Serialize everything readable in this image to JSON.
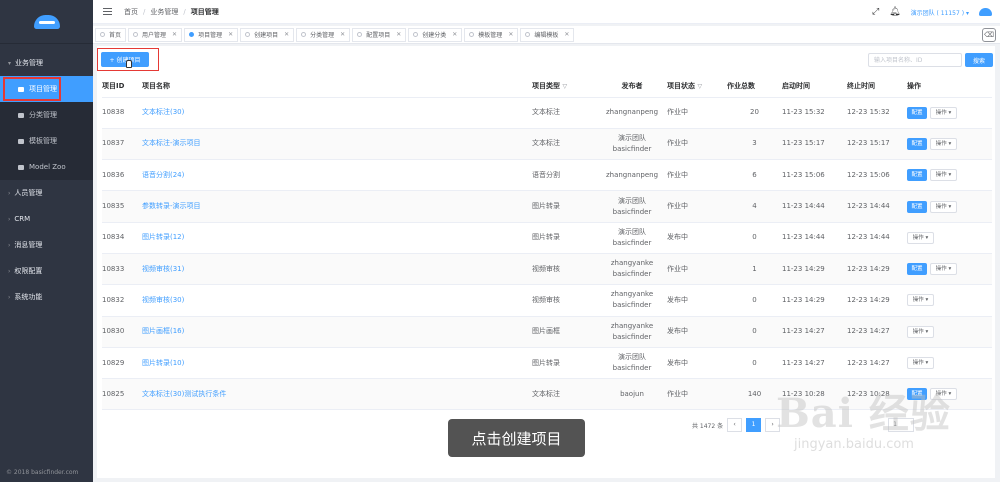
{
  "header": {
    "breadcrumb": [
      "首页",
      "业务管理",
      "项目管理"
    ],
    "user_label": "演示团队 ( 11157 ) ▾"
  },
  "sidebar": {
    "group_business": "业务管理",
    "items": [
      "项目管理",
      "分类管理",
      "模板管理",
      "Model Zoo"
    ],
    "groups": [
      "人员管理",
      "CRM",
      "消息管理",
      "权限配置",
      "系统功能"
    ],
    "footer": "© 2018 basicfinder.com"
  },
  "tabs": [
    {
      "label": "首页"
    },
    {
      "label": "用户管理"
    },
    {
      "label": "项目管理"
    },
    {
      "label": "创建项目"
    },
    {
      "label": "分类管理"
    },
    {
      "label": "配置项目"
    },
    {
      "label": "创建分类"
    },
    {
      "label": "模板管理"
    },
    {
      "label": "编辑模板"
    }
  ],
  "toolbar": {
    "create_label": "+ 创建项目",
    "search_placeholder": "输入项目名称、ID",
    "search_button": "搜索"
  },
  "table": {
    "headers": [
      "项目ID",
      "项目名称",
      "项目类型",
      "发布者",
      "项目状态",
      "作业总数",
      "启动时间",
      "终止时间",
      "操作"
    ],
    "filter_icon": "filter-icon",
    "config_label": "配置",
    "op_label": "操作 ▾",
    "rows": [
      {
        "id": "10838",
        "name": "文本标注(30)",
        "type": "文本标注",
        "publisher": [
          "zhangnanpeng"
        ],
        "status": "作业中",
        "total": "20",
        "start": "11-23 15:32",
        "end": "12-23 15:32",
        "config": true
      },
      {
        "id": "10837",
        "name": "文本标注-演示项目",
        "type": "文本标注",
        "publisher": [
          "演示团队",
          "basicfinder"
        ],
        "status": "作业中",
        "total": "3",
        "start": "11-23 15:17",
        "end": "12-23 15:17",
        "config": true
      },
      {
        "id": "10836",
        "name": "语音分割(24)",
        "type": "语音分割",
        "publisher": [
          "zhangnanpeng"
        ],
        "status": "作业中",
        "total": "6",
        "start": "11-23 15:06",
        "end": "12-23 15:06",
        "config": true
      },
      {
        "id": "10835",
        "name": "参数转录-演示项目",
        "type": "图片转录",
        "publisher": [
          "演示团队",
          "basicfinder"
        ],
        "status": "作业中",
        "total": "4",
        "start": "11-23 14:44",
        "end": "12-23 14:44",
        "config": true
      },
      {
        "id": "10834",
        "name": "图片转录(12)",
        "type": "图片转录",
        "publisher": [
          "演示团队",
          "basicfinder"
        ],
        "status": "发布中",
        "total": "0",
        "start": "11-23 14:44",
        "end": "12-23 14:44",
        "config": false
      },
      {
        "id": "10833",
        "name": "视频审核(31)",
        "type": "视频审核",
        "publisher": [
          "zhangyanke",
          "basicfinder"
        ],
        "status": "作业中",
        "total": "1",
        "start": "11-23 14:29",
        "end": "12-23 14:29",
        "config": true
      },
      {
        "id": "10832",
        "name": "视频审核(30)",
        "type": "视频审核",
        "publisher": [
          "zhangyanke",
          "basicfinder"
        ],
        "status": "发布中",
        "total": "0",
        "start": "11-23 14:29",
        "end": "12-23 14:29",
        "config": false
      },
      {
        "id": "10830",
        "name": "图片画框(16)",
        "type": "图片画框",
        "publisher": [
          "zhangyanke",
          "basicfinder"
        ],
        "status": "发布中",
        "total": "0",
        "start": "11-23 14:27",
        "end": "12-23 14:27",
        "config": false
      },
      {
        "id": "10829",
        "name": "图片转录(10)",
        "type": "图片转录",
        "publisher": [
          "演示团队",
          "basicfinder"
        ],
        "status": "发布中",
        "total": "0",
        "start": "11-23 14:27",
        "end": "12-23 14:27",
        "config": false
      },
      {
        "id": "10825",
        "name": "文本标注(30)测试执行条件",
        "type": "文本标注",
        "publisher": [
          "baojun"
        ],
        "status": "作业中",
        "total": "140",
        "start": "11-23 10:28",
        "end": "12-23 10:28",
        "config": true
      }
    ]
  },
  "pagination": {
    "total": "共 1472 条",
    "prev": "‹",
    "page": "1",
    "next": "›",
    "jump_value": "1"
  },
  "overlay": {
    "caption": "点击创建项目",
    "watermark": "Bai 经验",
    "watermark_sub": "jingyan.baidu.com"
  }
}
